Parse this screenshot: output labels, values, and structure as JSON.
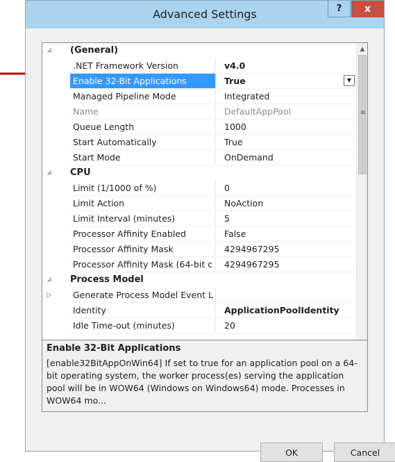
{
  "window": {
    "title": "Advanced Settings",
    "help_glyph": "?",
    "close_glyph": "x"
  },
  "grid": {
    "rows": [
      {
        "kind": "cat",
        "expander": "⊿",
        "name": "(General)"
      },
      {
        "kind": "prop",
        "name": ".NET Framework Version",
        "value": "v4.0",
        "value_bold": true
      },
      {
        "kind": "prop",
        "name": "Enable 32-Bit Applications",
        "value": "True",
        "selected": true,
        "value_bold": true
      },
      {
        "kind": "prop",
        "name": "Managed Pipeline Mode",
        "value": "Integrated"
      },
      {
        "kind": "prop",
        "name": "Name",
        "value": "DefaultAppPool",
        "disabled": true
      },
      {
        "kind": "prop",
        "name": "Queue Length",
        "value": "1000"
      },
      {
        "kind": "prop",
        "name": "Start Automatically",
        "value": "True"
      },
      {
        "kind": "prop",
        "name": "Start Mode",
        "value": "OnDemand"
      },
      {
        "kind": "cat",
        "expander": "⊿",
        "name": "CPU"
      },
      {
        "kind": "prop",
        "name": "Limit (1/1000 of %)",
        "value": "0"
      },
      {
        "kind": "prop",
        "name": "Limit Action",
        "value": "NoAction"
      },
      {
        "kind": "prop",
        "name": "Limit Interval (minutes)",
        "value": "5"
      },
      {
        "kind": "prop",
        "name": "Processor Affinity Enabled",
        "value": "False"
      },
      {
        "kind": "prop",
        "name": "Processor Affinity Mask",
        "value": "4294967295"
      },
      {
        "kind": "prop",
        "name": "Processor Affinity Mask (64-bit c",
        "value": "4294967295"
      },
      {
        "kind": "cat",
        "expander": "⊿",
        "name": "Process Model"
      },
      {
        "kind": "prop",
        "expander": "▷",
        "name": "Generate Process Model Event L",
        "value": ""
      },
      {
        "kind": "prop",
        "name": "Identity",
        "value": "ApplicationPoolIdentity",
        "value_bold": true
      },
      {
        "kind": "prop",
        "name": "Idle Time-out (minutes)",
        "value": "20"
      }
    ]
  },
  "description": {
    "title": "Enable 32-Bit Applications",
    "text": "[enable32BitAppOnWin64] If set to true for an application pool on a 64-bit operating system, the worker process(es) serving the application pool will be in WOW64 (Windows on Windows64) mode. Processes in WOW64 mo..."
  },
  "buttons": {
    "ok": "OK",
    "cancel": "Cancel"
  },
  "colors": {
    "selection": "#3399ff",
    "title_bar": "#aad3f0",
    "close": "#c7503f",
    "arrow": "#c00000"
  }
}
